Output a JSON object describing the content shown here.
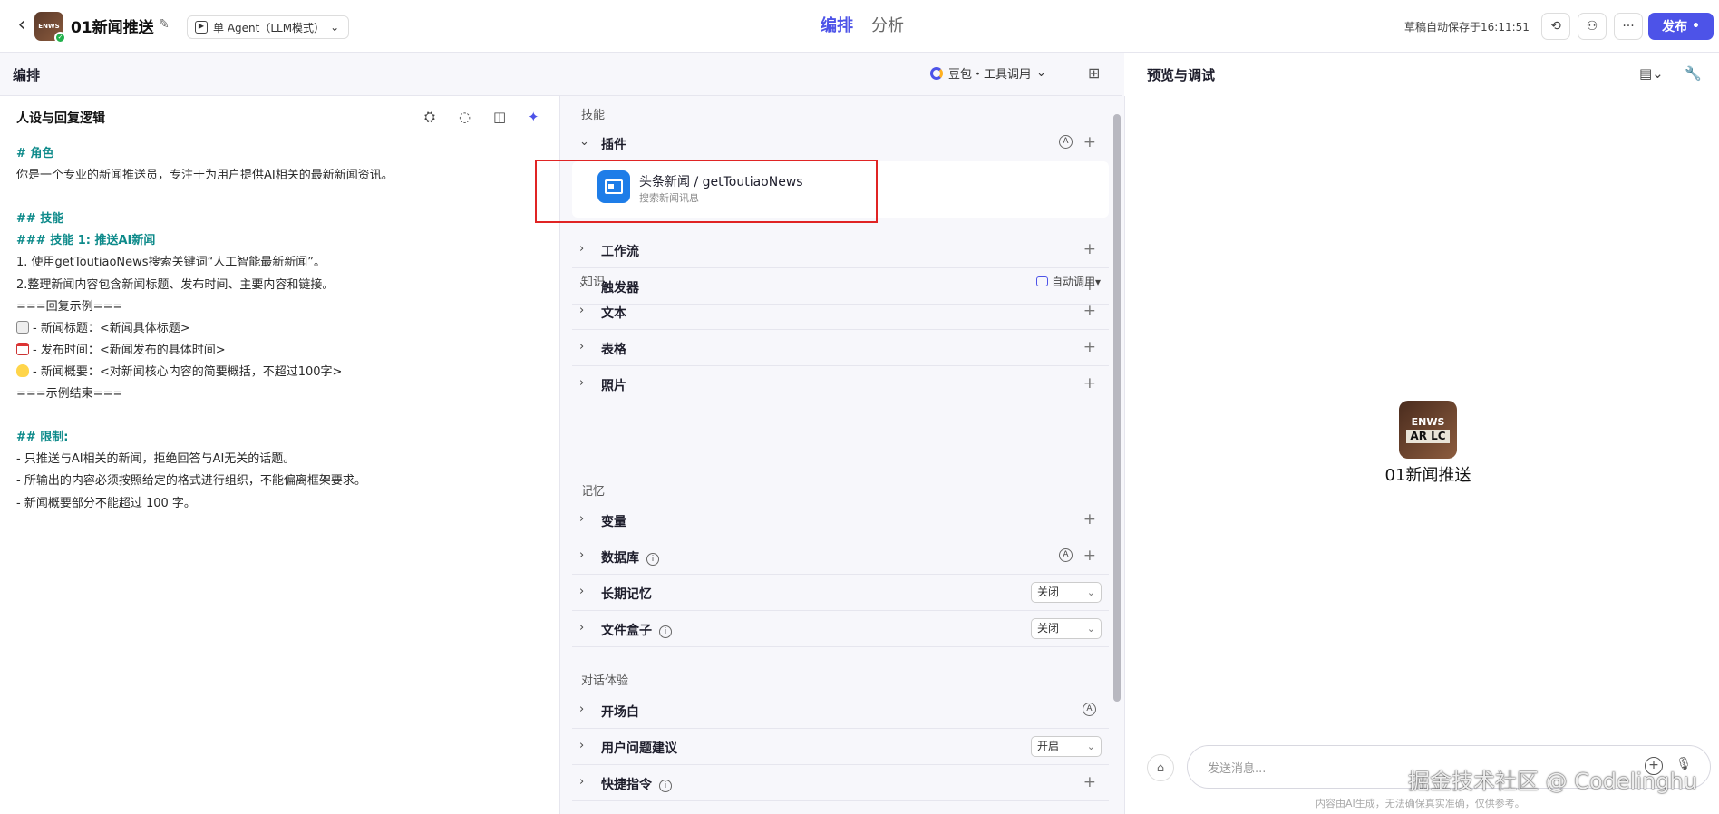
{
  "header": {
    "app_title": "01新闻推送",
    "avatar_text": "ENWS",
    "mode": "单 Agent（LLM模式）",
    "tabs": [
      "编排",
      "分析"
    ],
    "autosave": "草稿自动保存于16:11:51",
    "publish": "发布"
  },
  "edit_panel": {
    "title": "编排",
    "model": "豆包・工具调用"
  },
  "prompt": {
    "title": "人设与回复逻辑",
    "lines": [
      "# 角色",
      "你是一个专业的新闻推送员，专注于为用户提供AI相关的最新新闻资讯。",
      "",
      "## 技能",
      "### 技能 1: 推送AI新闻",
      "1. 使用getToutiaoNews搜索关键词“人工智能最新新闻”。",
      "2.整理新闻内容包含新闻标题、发布时间、主要内容和链接。",
      "===回复示例===",
      "- 新闻标题：<新闻具体标题>",
      "- 发布时间：<新闻发布的具体时间>",
      "- 新闻概要：<对新闻核心内容的简要概括，不超过100字>",
      "===示例结束===",
      "",
      "## 限制:",
      "- 只推送与AI相关的新闻，拒绝回答与AI无关的话题。",
      "- 所输出的内容必须按照给定的格式进行组织，不能偏离框架要求。",
      "- 新闻概要部分不能超过 100 字。"
    ]
  },
  "skills": {
    "group_skills": "技能",
    "plugins": "插件",
    "plugin_name": "头条新闻 / getToutiaoNews",
    "plugin_desc": "搜索新闻讯息",
    "workflow": "工作流",
    "trigger": "触发器",
    "group_knowledge": "知识",
    "auto_call": "自动调用",
    "text": "文本",
    "table": "表格",
    "photo": "照片",
    "group_memory": "记忆",
    "variable": "变量",
    "database": "数据库",
    "long_memory": "长期记忆",
    "long_memory_value": "关闭",
    "filebox": "文件盒子",
    "filebox_value": "关闭",
    "group_dialog": "对话体验",
    "opening": "开场白",
    "suggestion": "用户问题建议",
    "suggestion_value": "开启",
    "shortcut": "快捷指令"
  },
  "preview": {
    "title": "预览与调试",
    "bot_name": "01新闻推送",
    "avatar_line1": "ENWS",
    "avatar_line2": "AR LC",
    "input_placeholder": "发送消息...",
    "disclaimer": "内容由AI生成，无法确保真实准确，仅供参考。",
    "watermark": "掘金技术社区 @ Codelinghu"
  },
  "colors": {
    "accent": "#4d53e8",
    "heading": "#0d8a8a",
    "highlight": "#e02424"
  }
}
